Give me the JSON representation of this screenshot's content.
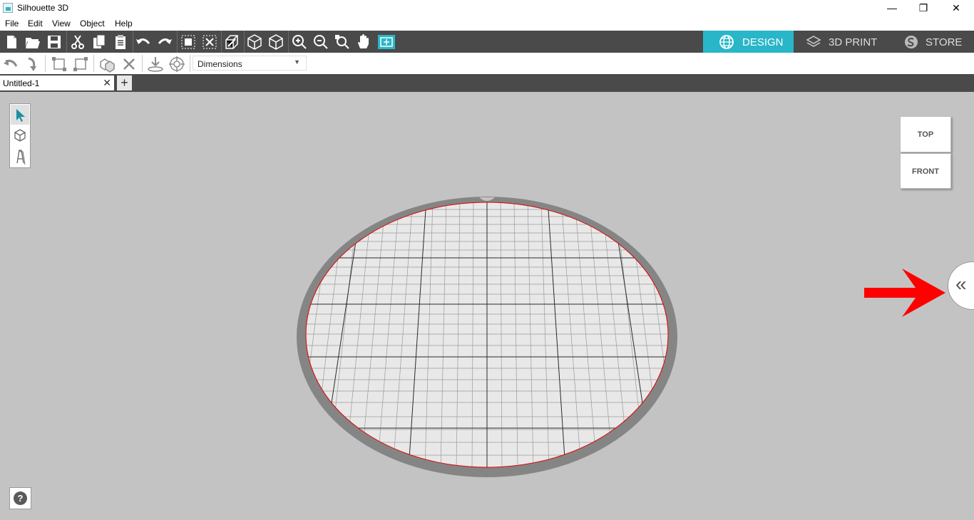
{
  "window": {
    "title": "Silhouette 3D",
    "minimize_glyph": "—",
    "restore_glyph": "❐",
    "close_glyph": "✕"
  },
  "menu": [
    {
      "label": "File"
    },
    {
      "label": "Edit"
    },
    {
      "label": "View"
    },
    {
      "label": "Object"
    },
    {
      "label": "Help"
    }
  ],
  "toolbar_icons": [
    "new-file-icon",
    "open-folder-icon",
    "save-icon",
    "cut-icon",
    "copy-icon",
    "paste-icon",
    "undo-icon",
    "redo-icon",
    "group-icon",
    "ungroup-icon",
    "extrude-icon",
    "cube-icon",
    "cube-outline-icon",
    "zoom-in-icon",
    "zoom-out-icon",
    "zoom-fit-icon",
    "pan-hand-icon",
    "grid-select-icon"
  ],
  "mode_tabs": [
    {
      "label": "DESIGN",
      "icon": "globe-icon",
      "active": true
    },
    {
      "label": "3D PRINT",
      "icon": "printer-layers-icon",
      "active": false
    },
    {
      "label": "STORE",
      "icon": "store-s-icon",
      "active": false
    }
  ],
  "toolbar2": {
    "dimensions_select": "Dimensions",
    "icons": [
      "rotate-left-icon",
      "rotate-down-icon",
      "align-icon",
      "distribute-icon",
      "boolean-icon",
      "delete-icon",
      "drop-to-bed-icon",
      "center-icon"
    ]
  },
  "doc_tab": {
    "name": "Untitled-1",
    "close_glyph": "✕",
    "add_glyph": "+"
  },
  "view_cube": {
    "top_label": "TOP",
    "front_label": "FRONT"
  },
  "panel_toggle_glyph": "«",
  "help_glyph": "?",
  "colors": {
    "accent": "#29b6c8",
    "toolbar_bg": "#4a4a4a",
    "canvas_bg": "#c3c3c3",
    "annotation_arrow": "#ff0000"
  }
}
